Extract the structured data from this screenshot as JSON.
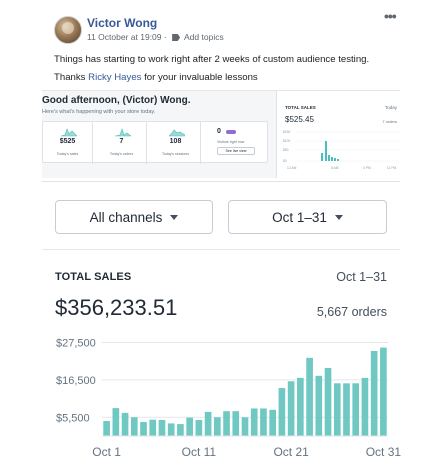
{
  "post": {
    "author": "Victor Wong",
    "timestamp": "11 October at 19:09",
    "add_topics": "Add topics",
    "more_icon": "more-dots-icon",
    "text_line1": "Things has starting to work right after 2 weeks of custom audience testing.",
    "text_thanks": "Thanks ",
    "mention": "Ricky Hayes",
    "text_after_mention": " for your invaluable lessons"
  },
  "embed": {
    "greeting": "Good afternoon, (Victor) Wong.",
    "subtitle": "Here's what's happening with your store today.",
    "stats": [
      {
        "value": "$525",
        "label": "Today's sales"
      },
      {
        "value": "7",
        "label": "Today's orders"
      },
      {
        "value": "108",
        "label": "Today's sessions"
      }
    ],
    "visitors": {
      "value": "0",
      "label": "Visitors right now",
      "button": "See live view"
    },
    "sales": {
      "title": "TOTAL SALES",
      "range": "Today",
      "amount": "$525.45",
      "orders": "7 orders",
      "y_ticks": [
        "$150",
        "$100",
        "$50",
        "$0"
      ],
      "x_ticks": [
        "12 AM",
        "8 AM",
        "4 PM",
        "11 PM"
      ]
    }
  },
  "filters": {
    "channels": "All channels",
    "period": "Oct 1–31"
  },
  "total_sales": {
    "title": "TOTAL SALES",
    "range": "Oct 1–31",
    "amount": "$356,233.51",
    "orders": "5,667 orders"
  },
  "colors": {
    "bar": "#6fc8c2",
    "link": "#385898"
  },
  "chart_data": {
    "type": "bar",
    "title": "TOTAL SALES",
    "x": [
      1,
      2,
      3,
      4,
      5,
      6,
      7,
      8,
      9,
      10,
      11,
      12,
      13,
      14,
      15,
      16,
      17,
      18,
      19,
      20,
      21,
      22,
      23,
      24,
      25,
      26,
      27,
      28,
      29,
      30,
      31
    ],
    "values": [
      4400,
      8200,
      6800,
      5500,
      4100,
      4800,
      4700,
      3700,
      3500,
      5400,
      4700,
      7100,
      5500,
      7300,
      7300,
      5500,
      8100,
      8100,
      7700,
      14100,
      16100,
      17100,
      23000,
      17700,
      20000,
      15500,
      15500,
      15500,
      17100,
      25000,
      26000
    ],
    "x_tick_labels": [
      "Oct 1",
      "Oct 11",
      "Oct 21",
      "Oct 31"
    ],
    "x_tick_at": [
      1,
      11,
      21,
      31
    ],
    "y_tick_labels": [
      "$27,500",
      "$16,500",
      "$5,500"
    ],
    "y_tick_at": [
      27500,
      16500,
      5500
    ],
    "ylim": [
      0,
      30000
    ],
    "grid": true
  }
}
